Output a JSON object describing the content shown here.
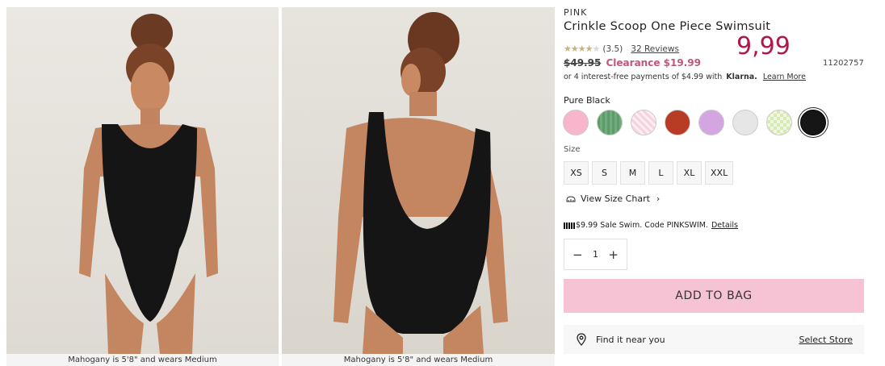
{
  "gallery": {
    "caption_1": "Mahogany is 5'8\" and wears Medium",
    "caption_2": "Mahogany is 5'8\" and wears Medium"
  },
  "product": {
    "brand": "PINK",
    "title": "Crinkle Scoop One Piece Swimsuit",
    "rating_value": 3.5,
    "rating_text": "(3.5)",
    "reviews_link": "32 Reviews",
    "overlay_price": "9,99",
    "old_price": "$49.95",
    "clearance_price": "Clearance $19.99",
    "sku": "11202757",
    "klarna_text": "or 4 interest-free payments of $4.99 with",
    "klarna_brand": "Klarna.",
    "klarna_link": "Learn More"
  },
  "colors": {
    "selected_label": "Pure Black",
    "swatches": [
      {
        "name": "pink",
        "hex": "#f7b6cc"
      },
      {
        "name": "green",
        "hex": "#5f9a6a"
      },
      {
        "name": "light-pink-stripe",
        "hex": "#f6d3de"
      },
      {
        "name": "rust",
        "hex": "#b83b24"
      },
      {
        "name": "lilac",
        "hex": "#d3a6e2"
      },
      {
        "name": "light-gray",
        "hex": "#e6e6e6"
      },
      {
        "name": "lime-check",
        "hex": "#d6ebb2"
      },
      {
        "name": "pure-black",
        "hex": "#161616"
      }
    ]
  },
  "size": {
    "label": "Size",
    "options": [
      "XS",
      "S",
      "M",
      "L",
      "XL",
      "XXL"
    ],
    "chart_link": "View Size Chart"
  },
  "promo": {
    "text": "$9.99 Sale Swim. Code PINKSWIM.",
    "details_link": "Details"
  },
  "quantity": {
    "minus": "−",
    "value": "1",
    "plus": "+"
  },
  "cart": {
    "add_label": "ADD TO BAG"
  },
  "store": {
    "find_label": "Find it near you",
    "select_link": "Select Store"
  },
  "colors_theme": {
    "accent": "#b1174b",
    "sale": "#c0567d",
    "button": "#f5c3d3"
  },
  "icons": [
    "star-icon",
    "size-chart-icon",
    "chevron-right-icon",
    "minus-icon",
    "plus-icon",
    "location-pin-icon",
    "flag-icon"
  ]
}
